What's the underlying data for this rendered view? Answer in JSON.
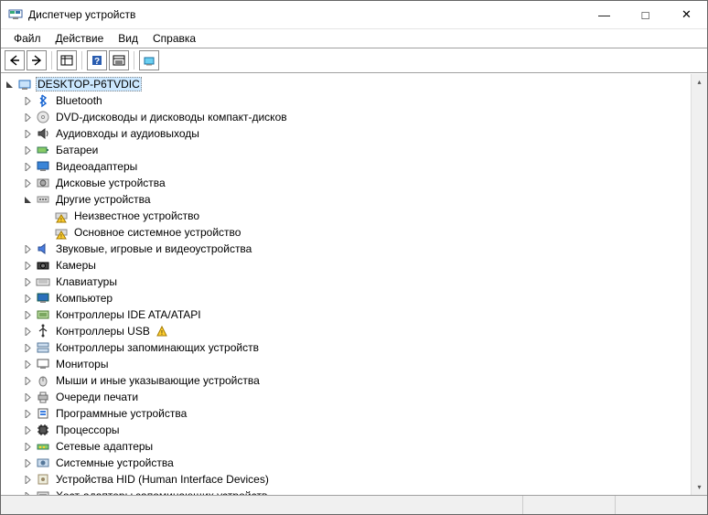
{
  "window": {
    "title": "Диспетчер устройств"
  },
  "menu": {
    "file": "Файл",
    "action": "Действие",
    "view": "Вид",
    "help": "Справка"
  },
  "tree": {
    "root": "DESKTOP-P6TVDIC",
    "items": [
      {
        "label": "Bluetooth",
        "icon": "bluetooth",
        "expand": "closed"
      },
      {
        "label": "DVD-дисководы и дисководы компакт-дисков",
        "icon": "disc",
        "expand": "closed"
      },
      {
        "label": "Аудиовходы и аудиовыходы",
        "icon": "audio",
        "expand": "closed"
      },
      {
        "label": "Батареи",
        "icon": "battery",
        "expand": "closed"
      },
      {
        "label": "Видеоадаптеры",
        "icon": "display",
        "expand": "closed"
      },
      {
        "label": "Дисковые устройства",
        "icon": "drive",
        "expand": "closed"
      },
      {
        "label": "Другие устройства",
        "icon": "other",
        "expand": "open",
        "children": [
          {
            "label": "Неизвестное устройство",
            "icon": "warn"
          },
          {
            "label": "Основное системное устройство",
            "icon": "warn"
          }
        ]
      },
      {
        "label": "Звуковые, игровые и видеоустройства",
        "icon": "sound",
        "expand": "closed"
      },
      {
        "label": "Камеры",
        "icon": "camera",
        "expand": "closed"
      },
      {
        "label": "Клавиатуры",
        "icon": "keyboard",
        "expand": "closed"
      },
      {
        "label": "Компьютер",
        "icon": "computer",
        "expand": "closed"
      },
      {
        "label": "Контроллеры IDE ATA/ATAPI",
        "icon": "ide",
        "expand": "closed"
      },
      {
        "label": "Контроллеры USB",
        "icon": "usb",
        "expand": "closed",
        "warn": true
      },
      {
        "label": "Контроллеры запоминающих устройств",
        "icon": "storage",
        "expand": "closed"
      },
      {
        "label": "Мониторы",
        "icon": "monitor",
        "expand": "closed"
      },
      {
        "label": "Мыши и иные указывающие устройства",
        "icon": "mouse",
        "expand": "closed"
      },
      {
        "label": "Очереди печати",
        "icon": "printer",
        "expand": "closed"
      },
      {
        "label": "Программные устройства",
        "icon": "software",
        "expand": "closed"
      },
      {
        "label": "Процессоры",
        "icon": "cpu",
        "expand": "closed"
      },
      {
        "label": "Сетевые адаптеры",
        "icon": "network",
        "expand": "closed"
      },
      {
        "label": "Системные устройства",
        "icon": "system",
        "expand": "closed"
      },
      {
        "label": "Устройства HID (Human Interface Devices)",
        "icon": "hid",
        "expand": "closed"
      },
      {
        "label": "Хост-адаптеры запоминающих устройств",
        "icon": "hostadapter",
        "expand": "closed"
      }
    ]
  }
}
